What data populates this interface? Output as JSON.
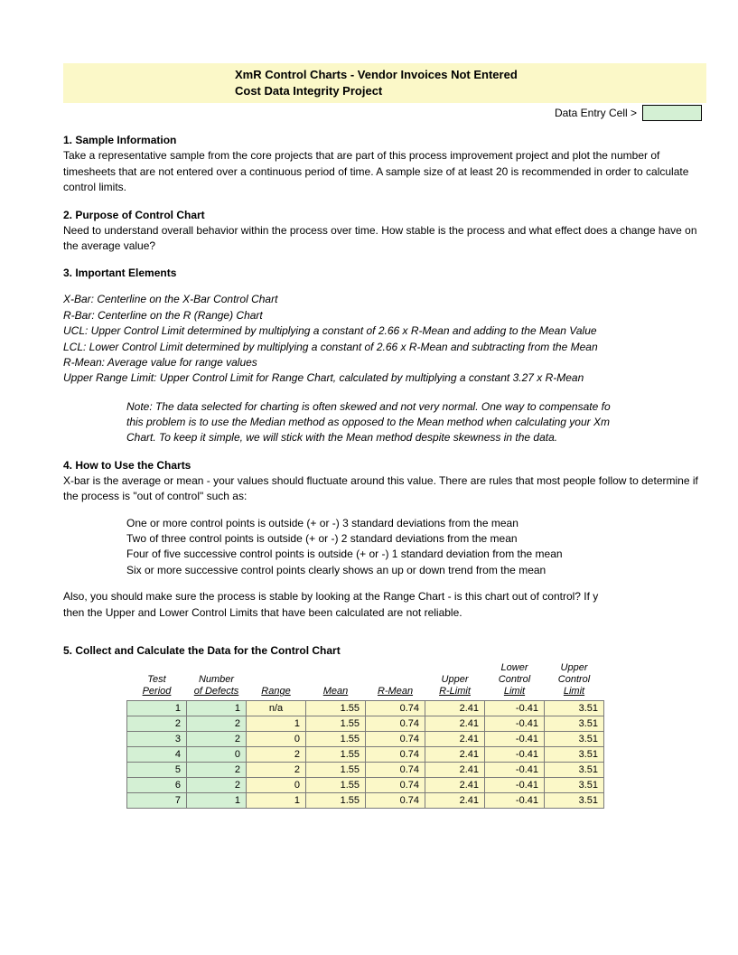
{
  "title": {
    "line1": "XmR Control Charts - Vendor Invoices Not Entered",
    "line2": "Cost Data Integrity Project"
  },
  "legend": {
    "label": "Data Entry Cell >"
  },
  "s1": {
    "head": "1. Sample Information",
    "body": "Take a representative sample from the core projects that are part of this process improvement project and plot the number of timesheets that are not entered over a continuous period of time.  A sample size of at least 20 is recommended in order to calculate control limits."
  },
  "s2": {
    "head": "2. Purpose of Control Chart",
    "body": "Need to understand overall behavior within the process over time. How stable is the process and what effect does a change have on the average value?"
  },
  "s3": {
    "head": "3. Important Elements",
    "d1": "X-Bar: Centerline on the X-Bar Control Chart",
    "d2": "R-Bar: Centerline on the R (Range) Chart",
    "d3": "UCL: Upper Control Limit determined by multiplying a constant of 2.66 x R-Mean and adding to the Mean Value",
    "d4": "LCL: Lower Control Limit determined by multiplying a constant of 2.66 x R-Mean and subtracting from the Mean",
    "d5": "R-Mean: Average value for range values",
    "d6": "Upper Range Limit: Upper Control Limit for Range Chart, calculated by multiplying a constant 3.27 x R-Mean",
    "note1": "Note: The data selected for charting is often skewed and not very normal. One way to compensate fo",
    "note2": "this problem is to use the Median method as opposed to the Mean method when calculating your Xm",
    "note3": "Chart. To keep it simple, we will stick with the Mean method despite skewness in the data."
  },
  "s4": {
    "head": "4. How to Use the Charts",
    "intro": "X-bar is the average or mean - your values should fluctuate around this value. There are rules that most people follow to determine if the process is \"out of control\" such as:",
    "r1": "One or more control points is outside (+ or -) 3 standard deviations from the mean",
    "r2": "Two of three control points is outside (+ or -) 2 standard deviations from the mean",
    "r3": "Four of five successive control points is outside (+ or -) 1 standard deviation from the mean",
    "r4": "Six or more successive control points clearly shows an up or down trend from the mean",
    "outro1": "Also, you should make sure the process is stable by looking at the Range Chart - is this chart out of control? If y",
    "outro2": "then the Upper and Lower Control Limits that have been calculated are not reliable."
  },
  "s5": {
    "head": "5. Collect and Calculate the Data for the Control Chart"
  },
  "table": {
    "headers": [
      [
        "Test",
        "Period"
      ],
      [
        "Number",
        "of Defects"
      ],
      [
        "",
        "Range"
      ],
      [
        "",
        "Mean"
      ],
      [
        "",
        "R-Mean"
      ],
      [
        "Upper",
        "R-Limit"
      ],
      [
        "Lower",
        "Control",
        "Limit"
      ],
      [
        "Upper",
        "Control",
        "Limit"
      ]
    ],
    "rows": [
      [
        "1",
        "1",
        "n/a",
        "1.55",
        "0.74",
        "2.41",
        "-0.41",
        "3.51"
      ],
      [
        "2",
        "2",
        "1",
        "1.55",
        "0.74",
        "2.41",
        "-0.41",
        "3.51"
      ],
      [
        "3",
        "2",
        "0",
        "1.55",
        "0.74",
        "2.41",
        "-0.41",
        "3.51"
      ],
      [
        "4",
        "0",
        "2",
        "1.55",
        "0.74",
        "2.41",
        "-0.41",
        "3.51"
      ],
      [
        "5",
        "2",
        "2",
        "1.55",
        "0.74",
        "2.41",
        "-0.41",
        "3.51"
      ],
      [
        "6",
        "2",
        "0",
        "1.55",
        "0.74",
        "2.41",
        "-0.41",
        "3.51"
      ],
      [
        "7",
        "1",
        "1",
        "1.55",
        "0.74",
        "2.41",
        "-0.41",
        "3.51"
      ]
    ]
  }
}
